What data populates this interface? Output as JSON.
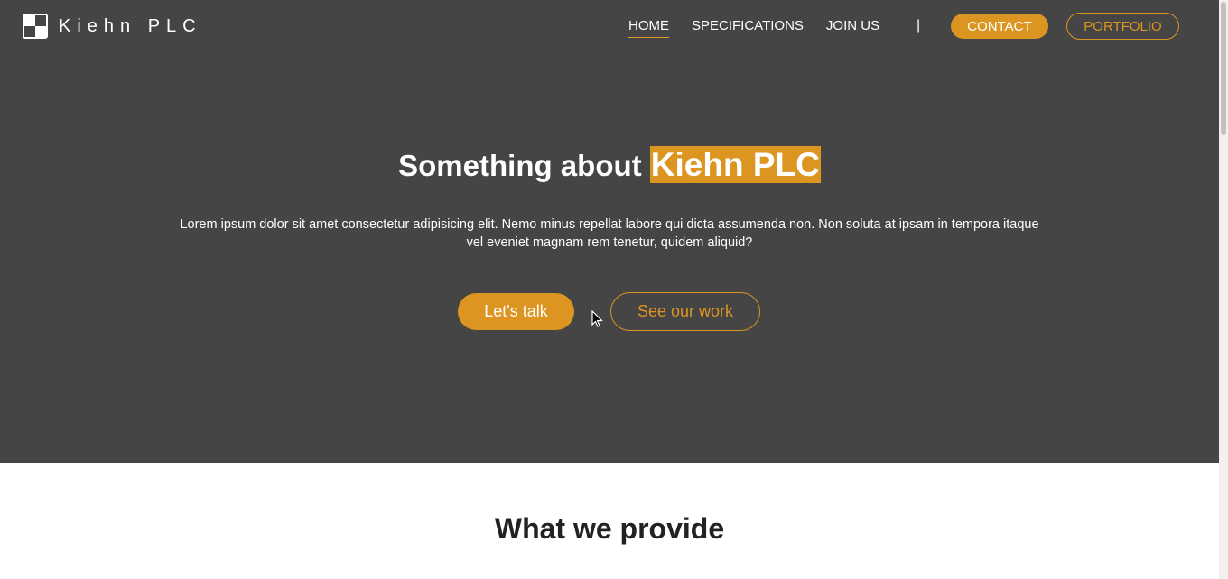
{
  "header": {
    "logo_text": "Kiehn PLC",
    "nav": [
      {
        "label": "HOME",
        "active": true
      },
      {
        "label": "SPECIFICATIONS",
        "active": false
      },
      {
        "label": "JOIN US",
        "active": false
      }
    ],
    "divider": "|",
    "contact_label": "CONTACT",
    "portfolio_label": "PORTFOLIO"
  },
  "hero": {
    "title_prefix": "Something about",
    "title_highlight": "Kiehn PLC",
    "text": "Lorem ipsum dolor sit amet consectetur adipisicing elit. Nemo minus repellat labore qui dicta assumenda non. Non soluta at ipsam in tempora itaque vel eveniet magnam rem tenetur, quidem aliquid?",
    "primary_button": "Let's talk",
    "secondary_button": "See our work"
  },
  "section": {
    "title": "What we provide"
  },
  "colors": {
    "accent": "#dc9520",
    "hero_bg": "#454545",
    "text_light": "#ffffff"
  },
  "icons": {
    "logo": "checkered-square-logo-icon",
    "cursor": "mouse-pointer-icon"
  }
}
